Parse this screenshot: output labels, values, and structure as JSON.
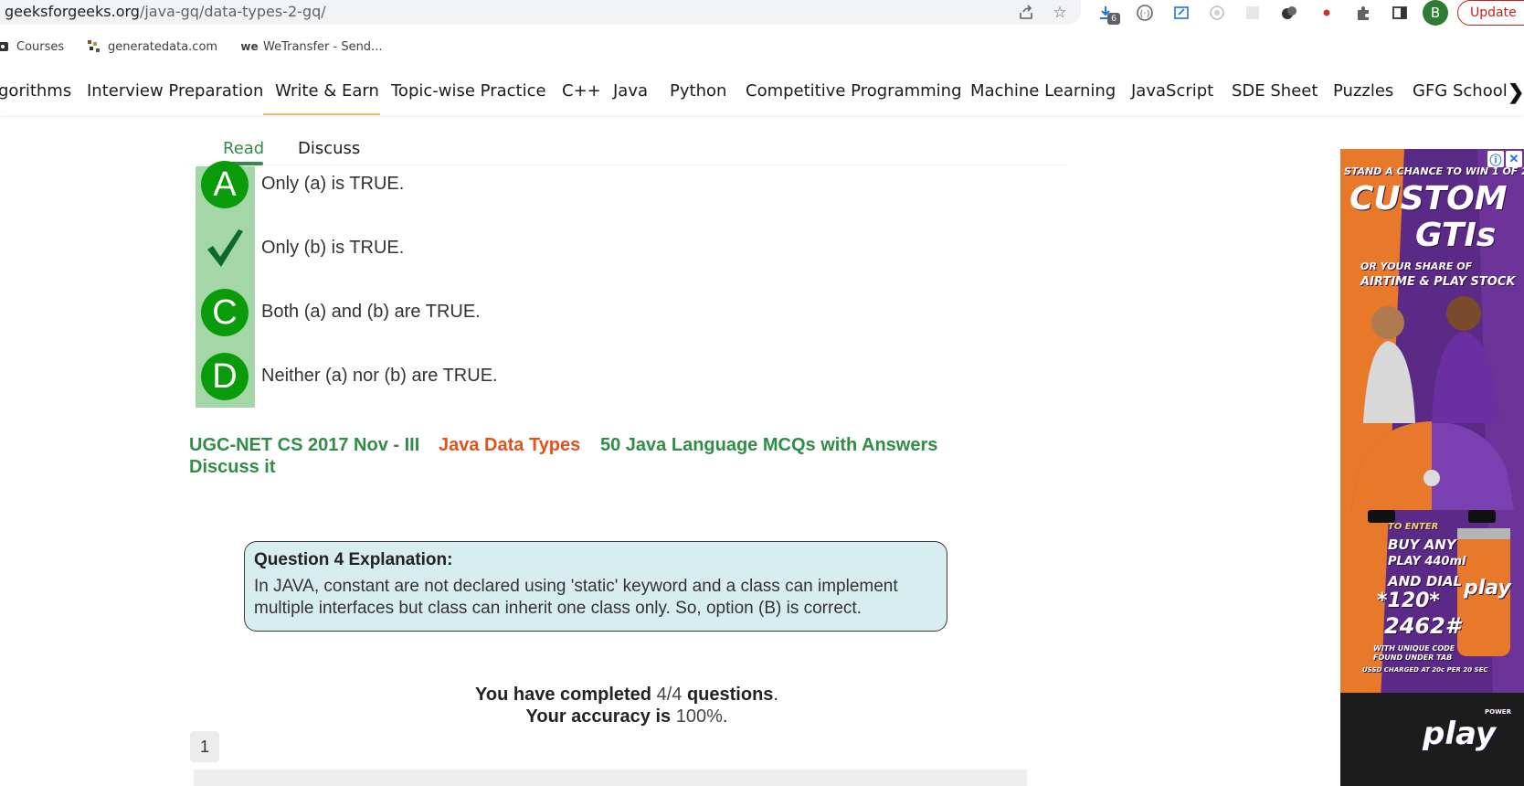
{
  "browser": {
    "url_domain": "geeksforgeeks.org",
    "url_path": "/java-gq/data-types-2-gq/",
    "download_count": "6",
    "avatar_letter": "B",
    "update_label": "Update"
  },
  "bookmarks": [
    {
      "label": "Courses",
      "icon": "courses-icon"
    },
    {
      "label": "generatedata.com",
      "icon": "generatedata-icon"
    },
    {
      "label": "WeTransfer - Send...",
      "icon": "wetransfer-icon"
    }
  ],
  "site_nav": {
    "items": [
      "gorithms",
      "Interview Preparation",
      "Write & Earn",
      "Topic-wise Practice",
      "C++",
      "Java",
      "Python",
      "Competitive Programming",
      "Machine Learning",
      "JavaScript",
      "SDE Sheet",
      "Puzzles",
      "GFG School"
    ],
    "next_glyph": "❯"
  },
  "article_tabs": {
    "read": "Read",
    "discuss": "Discuss"
  },
  "options": [
    {
      "marker": "A",
      "text": "Only (a) is TRUE.",
      "correct": false
    },
    {
      "marker": "✓",
      "text": "Only (b) is TRUE.",
      "correct": true
    },
    {
      "marker": "C",
      "text": "Both (a) and (b) are TRUE.",
      "correct": false
    },
    {
      "marker": "D",
      "text": "Neither (a) nor (b) are TRUE.",
      "correct": false
    }
  ],
  "tags": {
    "tag1": "UGC-NET CS 2017 Nov - III",
    "tag2": "Java Data Types",
    "tag3": "50 Java Language MCQs with Answers",
    "discuss": "Discuss it"
  },
  "explanation": {
    "title": "Question 4 Explanation:",
    "body": "In JAVA, constant are not declared using 'static' keyword and a class can implement multiple interfaces but class can inherit one class only. So, option (B) is correct."
  },
  "result": {
    "completed_prefix": "You have completed",
    "completed_value": "4/4",
    "completed_suffix": "questions",
    "accuracy_prefix": "Your accuracy is",
    "accuracy_value": "100%",
    "period": "."
  },
  "pagination": {
    "current": "1"
  },
  "ad": {
    "line1": "STAND A CHANCE TO WIN 1 OF 2",
    "line2": "CUSTOM",
    "line3": "GTIs",
    "line4": "OR YOUR SHARE OF",
    "line5": "AIRTIME & PLAY STOCK",
    "line6": "TO ENTER",
    "line7": "BUY ANY",
    "line8": "PLAY 440ml",
    "line9": "AND DIAL",
    "line10": "*120*",
    "line11": "2462#",
    "line12": "WITH UNIQUE CODE",
    "line13": "FOUND UNDER TAB",
    "line14": "USSD CHARGED AT 20c PER 20 SEC",
    "can_label": "play",
    "logo": "play",
    "logo_top": "POWER",
    "colors": {
      "purple": "#5b2a86",
      "orange": "#e8782a"
    }
  },
  "colors": {
    "gfg_green": "#2f8d46",
    "option_green": "#0a9b0a",
    "strip_green": "#a5d6a7",
    "tag_orange": "#e0541b",
    "explain_bg": "#d8edef"
  }
}
